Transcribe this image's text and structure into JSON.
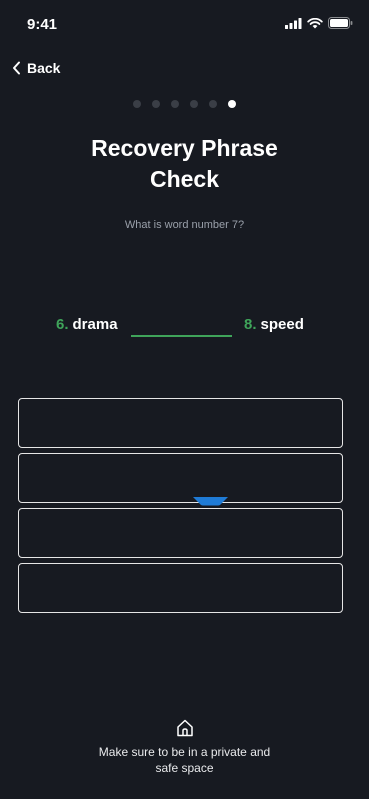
{
  "status_bar": {
    "time": "9:41",
    "icons": [
      "signal-icon",
      "wifi-icon",
      "battery-icon"
    ]
  },
  "nav": {
    "back_label": "Back",
    "back_icon": "chevron-left-icon"
  },
  "progress": {
    "total_steps": 6,
    "current_step": 6
  },
  "title": {
    "line1": "Recovery Phrase",
    "line2": "Check"
  },
  "prompt": "What is word number 7?",
  "sequence": {
    "prev_number": "6.",
    "prev_word": "drama",
    "next_number": "8.",
    "next_word": "speed"
  },
  "options": [
    {
      "label": ""
    },
    {
      "label": ""
    },
    {
      "label": ""
    },
    {
      "label": ""
    }
  ],
  "footer": {
    "icon": "home-icon",
    "line1": "Make sure to be in a private and",
    "line2": "safe space"
  },
  "colors": {
    "background": "#171a21",
    "accent_green": "#3fa45a",
    "handle_blue": "#1f7bd6",
    "text_muted": "#9aa0aa"
  }
}
